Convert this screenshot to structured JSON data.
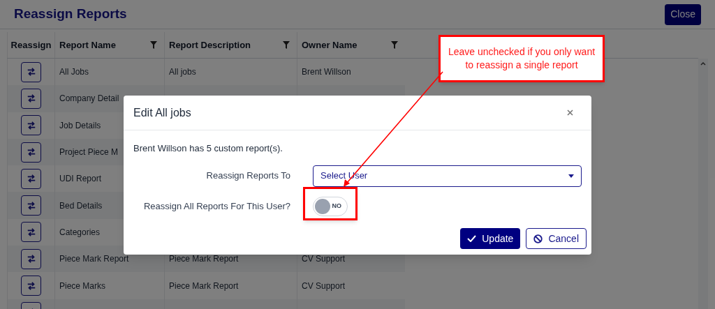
{
  "page": {
    "title": "Reassign Reports",
    "close_button": "Close"
  },
  "table": {
    "columns": [
      {
        "label": "Reassign",
        "filter": false
      },
      {
        "label": "Report Name",
        "filter": true
      },
      {
        "label": "Report Description",
        "filter": true
      },
      {
        "label": "Owner Name",
        "filter": true
      }
    ],
    "rows": [
      {
        "name": "All Jobs",
        "description": "All jobs",
        "owner": "Brent Willson"
      },
      {
        "name": "Company Detail"
      },
      {
        "name": "Job Details"
      },
      {
        "name": "Project Piece M"
      },
      {
        "name": "UDI Report"
      },
      {
        "name": "Bed Details"
      },
      {
        "name": "Categories"
      },
      {
        "name": "Piece Mark Report",
        "description": "Piece Mark Report",
        "owner": "CV Support"
      },
      {
        "name": "Piece Marks",
        "description": "Piece Mark Report",
        "owner": "CV Support"
      },
      {}
    ]
  },
  "modal": {
    "title": "Edit All jobs",
    "message": "Brent Willson has 5 custom report(s).",
    "fields": [
      {
        "kind": "select",
        "label": "Reassign Reports To",
        "value": "Select User"
      },
      {
        "kind": "toggle",
        "label": "Reassign All Reports For This User?",
        "on": false,
        "state_text": "NO"
      }
    ],
    "buttons": [
      {
        "kind": "primary",
        "label": "Update"
      },
      {
        "kind": "secondary",
        "label": "Cancel"
      }
    ]
  },
  "annotation": {
    "callout": "Leave unchecked if you only want to reassign a single report"
  }
}
